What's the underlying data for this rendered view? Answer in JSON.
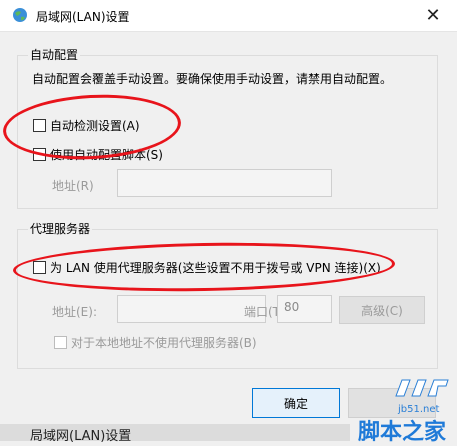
{
  "window": {
    "title": "局域网(LAN)设置",
    "close_label": "✕"
  },
  "auto_config": {
    "group_title": "自动配置",
    "description": "自动配置会覆盖手动设置。要确保使用手动设置，请禁用自动配置。",
    "auto_detect_label": "自动检测设置(A)",
    "auto_script_label": "使用自动配置脚本(S)",
    "address_label": "地址(R)",
    "address_value": ""
  },
  "proxy": {
    "group_title": "代理服务器",
    "use_proxy_label": "为 LAN 使用代理服务器(这些设置不用于拨号或 VPN 连接)(X)",
    "address_label": "地址(E):",
    "address_value": "",
    "port_label": "端口(T):",
    "port_value": "80",
    "advanced_label": "高级(C)",
    "bypass_local_label": "对于本地地址不使用代理服务器(B)"
  },
  "buttons": {
    "ok_label": "确定"
  },
  "background_window": {
    "title": "局域网(LAN)设置"
  },
  "watermark": {
    "logo": "…JB51.NET 脚本之家 logo",
    "url": "jb51.net",
    "name": "脚本之家"
  },
  "colors": {
    "highlight": "#e8141b",
    "primary_button_border": "#0078d7"
  }
}
